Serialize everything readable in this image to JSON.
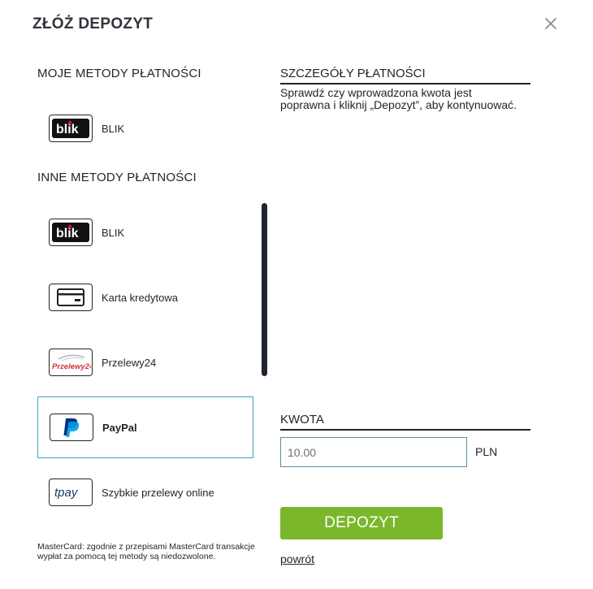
{
  "dialog": {
    "title": "ZŁÓŻ DEPOZYT"
  },
  "my_methods": {
    "heading": "MOJE METODY PŁATNOŚCI",
    "items": [
      {
        "label": "BLIK",
        "logo": "blik-logo"
      }
    ]
  },
  "other_methods": {
    "heading": "INNE METODY PŁATNOŚCI",
    "items": [
      {
        "label": "BLIK",
        "logo": "blik-logo"
      },
      {
        "label": "Karta kredytowa",
        "logo": "credit-card-icon"
      },
      {
        "label": "Przelewy24",
        "logo": "przelewy24-logo",
        "logo_text": "Przelewy24"
      },
      {
        "label": "PayPal",
        "logo": "paypal-logo",
        "selected": true
      },
      {
        "label": "Szybkie przelewy online",
        "logo": "tpay-logo",
        "logo_text": "tpay"
      }
    ]
  },
  "note": "MasterCard: zgodnie z przepisami MasterCard transakcje wypłat za pomocą tej metody są niedozwolone.",
  "details": {
    "heading": "SZCZEGÓŁY PŁATNOŚCI",
    "text": "Sprawdź czy wprowadzona kwota jest poprawna i kliknij „Depozyt”, aby kontynuować."
  },
  "amount": {
    "heading": "KWOTA",
    "value": "10.00",
    "currency": "PLN"
  },
  "actions": {
    "deposit_label": "DEPOZYT",
    "back_label": "powrót"
  },
  "colors": {
    "accent_green": "#7ab72a",
    "selected_border": "#3ea3c4",
    "blik_red": "#e30d3c",
    "paypal_dark": "#003087",
    "paypal_light": "#009cde",
    "tpay_blue": "#1a3a6b",
    "p24_red": "#d13239"
  }
}
